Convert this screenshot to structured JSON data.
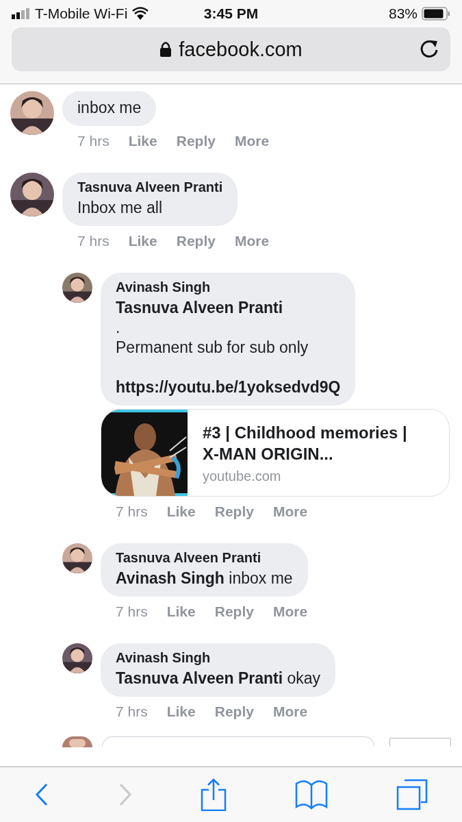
{
  "status_bar": {
    "carrier": "T-Mobile Wi-Fi",
    "time": "3:45 PM",
    "battery": "83%"
  },
  "address_bar": {
    "url": "facebook.com"
  },
  "comments": [
    {
      "lines": [
        {
          "kind": "text",
          "text": "inbox me"
        }
      ],
      "time": "7 hrs",
      "actions": [
        "Like",
        "Reply",
        "More"
      ]
    },
    {
      "author": "Tasnuva Alveen Pranti",
      "lines": [
        {
          "kind": "text",
          "text": "Inbox me all"
        }
      ],
      "time": "7 hrs",
      "actions": [
        "Like",
        "Reply",
        "More"
      ],
      "replies": [
        {
          "author": "Avinash Singh",
          "lines": [
            {
              "kind": "mention",
              "text": "Tasnuva Alveen Pranti"
            },
            {
              "kind": "text",
              "text": "."
            },
            {
              "kind": "text",
              "text": "Permanent sub for sub only"
            },
            {
              "kind": "blank"
            },
            {
              "kind": "link",
              "text": "https://youtu.be/1yoksedvd9Q"
            }
          ],
          "preview": {
            "title": "#3 | Childhood memories | X-MAN ORIGIN...",
            "domain": "youtube.com"
          },
          "time": "7 hrs",
          "actions": [
            "Like",
            "Reply",
            "More"
          ]
        },
        {
          "author": "Tasnuva Alveen Pranti",
          "lines": [
            {
              "kind": "text",
              "text": "**Avinash Singh** inbox me"
            }
          ],
          "time": "7 hrs",
          "actions": [
            "Like",
            "Reply",
            "More"
          ]
        },
        {
          "author": "Avinash Singh",
          "lines": [
            {
              "kind": "text",
              "text": "**Tasnuva Alveen Pranti** okay"
            }
          ],
          "time": "7 hrs",
          "actions": [
            "Like",
            "Reply",
            "More"
          ]
        }
      ]
    }
  ],
  "toolbar": [
    {
      "kind": "back",
      "disabled": false
    },
    {
      "kind": "forward",
      "disabled": true
    },
    {
      "kind": "share",
      "disabled": false
    },
    {
      "kind": "bookmarks",
      "disabled": false
    },
    {
      "kind": "tabs",
      "disabled": false
    }
  ]
}
